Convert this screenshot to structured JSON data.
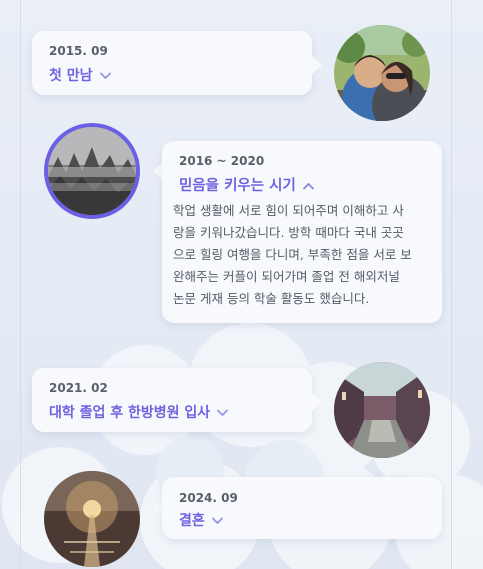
{
  "timeline": {
    "items": [
      {
        "date": "2015. 09",
        "title": "첫 만남",
        "expanded": false,
        "photo": "couple-selfie-photo"
      },
      {
        "date": "2016 ~ 2020",
        "title": "믿음을 키우는 시기",
        "expanded": true,
        "photo": "misty-forest-photo",
        "body": [
          "학업 생활에 서로 힘이 되어주며 이해하고 사",
          "랑을 키워나갔습니다. 방학 때마다 국내 곳곳",
          "으로 힐링 여행을 다니며, 부족한 점을 서로 보",
          "완해주는 커플이 되어가며 졸업 전 해외저널",
          "논문 게재 등의 학술 활동도 했습니다."
        ]
      },
      {
        "date": "2021. 02",
        "title": "대학 졸업 후 한방병원 입사",
        "expanded": false,
        "photo": "canal-street-photo"
      },
      {
        "date": "2024. 09",
        "title": "결혼",
        "expanded": false,
        "photo": "night-street-photo"
      }
    ]
  },
  "colors": {
    "accent": "#6f63e0",
    "date_text": "#5c5f6b",
    "body_text": "#565a66",
    "card": "#f7f9fc",
    "active_ring": "#6b5fe6"
  },
  "icons": {
    "collapsed": "chevron-down-icon",
    "expanded": "chevron-up-icon"
  }
}
